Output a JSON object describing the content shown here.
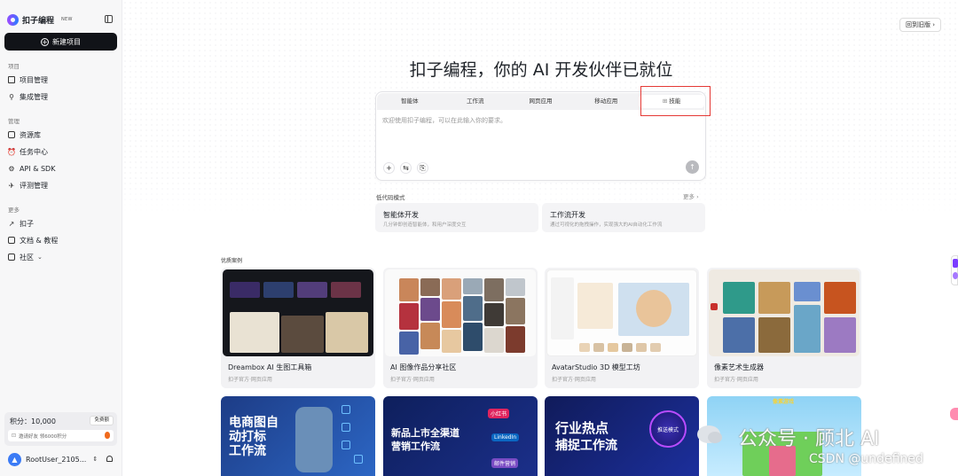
{
  "sidebar": {
    "logo_text": "扣子编程",
    "logo_badge": "NEW",
    "new_project": "新建项目",
    "sections": [
      {
        "title": "项目",
        "items": [
          {
            "label": "项目管理",
            "icon": "folder-icon"
          },
          {
            "label": "集成管理",
            "icon": "integration-icon"
          }
        ]
      },
      {
        "title": "管理",
        "items": [
          {
            "label": "资源库",
            "icon": "library-icon"
          },
          {
            "label": "任务中心",
            "icon": "alarm-icon"
          },
          {
            "label": "API & SDK",
            "icon": "api-icon"
          },
          {
            "label": "评测管理",
            "icon": "rocket-icon"
          }
        ]
      },
      {
        "title": "更多",
        "items": [
          {
            "label": "扣子",
            "icon": "arrow-icon"
          },
          {
            "label": "文档 & 教程",
            "icon": "book-icon"
          },
          {
            "label": "社区",
            "icon": "box-icon"
          }
        ]
      }
    ],
    "points_label": "积分：10,000",
    "points_button": "免费额",
    "invite_text": "邀请好友 领6000积分",
    "user_name": "RootUser_2105...",
    "avatar_letter": "▲"
  },
  "header": {
    "back_old": "回到旧版 ›"
  },
  "hero": {
    "title": "扣子编程，你的 AI 开发伙伴已就位"
  },
  "composer": {
    "tabs": [
      "智能体",
      "工作流",
      "网页应用",
      "移动应用",
      "技能"
    ],
    "active_tab_index": 4,
    "skill_icon": "skill-icon",
    "placeholder": "欢迎使用扣子编程，可以在此输入你的要求。",
    "add_icon": "+",
    "switch_icon": "⇆",
    "attach_icon": "⎘",
    "send_icon": "↑"
  },
  "lowcode": {
    "title": "低代码模式",
    "more": "更多  ›",
    "cards": [
      {
        "title": "智能体开发",
        "desc": "几分钟即创造智能体，和用户深度交互"
      },
      {
        "title": "工作流开发",
        "desc": "通过可视化的拖拽操作，实现强大的AI自动化工作流"
      }
    ]
  },
  "cases": {
    "title": "优质案例",
    "items": [
      {
        "name": "Dreambox AI 生图工具箱",
        "sub": "扣子官方·网页应用"
      },
      {
        "name": "AI 图像作品分享社区",
        "sub": "扣子官方·网页应用"
      },
      {
        "name": "AvatarStudio 3D 模型工坊",
        "sub": "扣子官方·网页应用"
      },
      {
        "name": "像素艺术生成器",
        "sub": "扣子官方·网页应用"
      }
    ],
    "bottom": [
      {
        "line1": "电商图自",
        "line2": "动打标",
        "line3": "工作流"
      },
      {
        "line1": "新品上市全渠道",
        "line2": "营销工作流",
        "badge1": "小红书",
        "badge2": "LinkedIn",
        "badge3": "邮件营销"
      },
      {
        "line1": "行业热点",
        "line2": "捕捉工作流",
        "badge1": "推送模式"
      },
      {
        "line1": "像素游戏"
      }
    ]
  },
  "watermark": {
    "line1": "公众号 · 顾北 AI",
    "line2": "CSDN @undefined"
  },
  "colors": {
    "accent": "#111318",
    "highlight_box": "#e53935",
    "sidebar_bg": "#f7f7f8"
  }
}
